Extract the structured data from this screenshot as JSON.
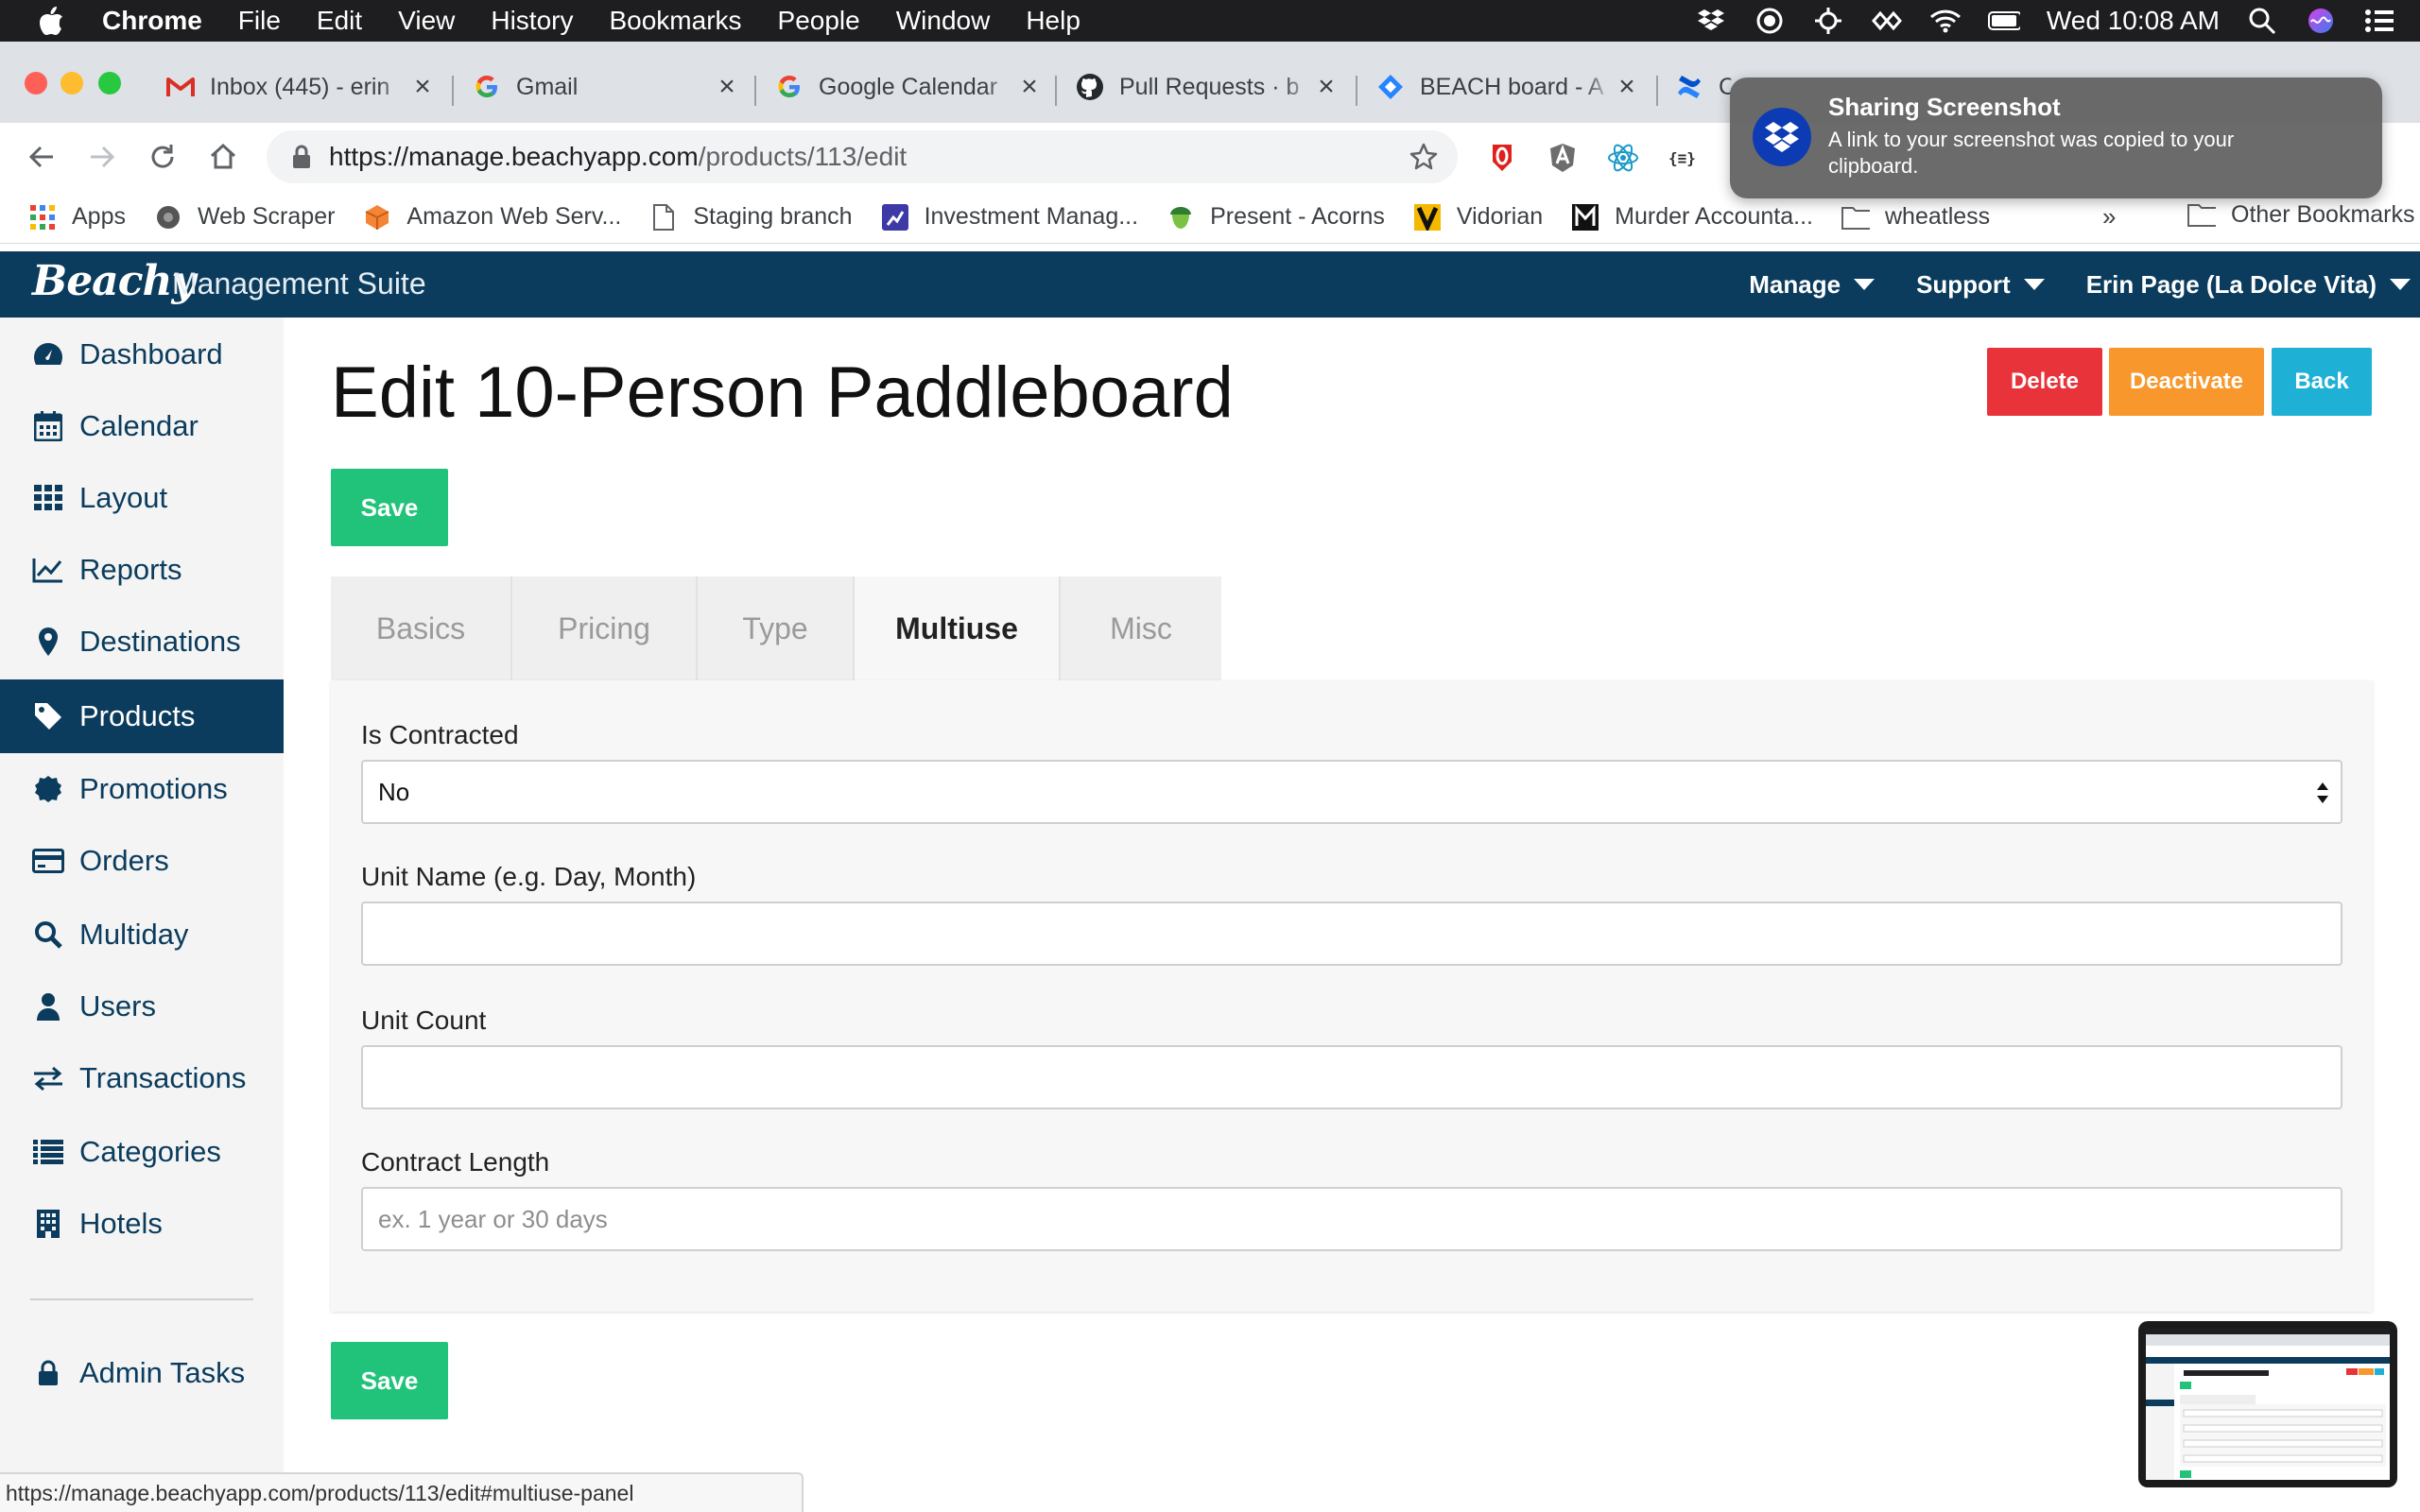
{
  "menubar": {
    "app_name": "Chrome",
    "items": [
      "File",
      "Edit",
      "View",
      "History",
      "Bookmarks",
      "People",
      "Window",
      "Help"
    ],
    "clock": "Wed 10:08 AM"
  },
  "tabs": [
    {
      "title": "Inbox (445) - erin",
      "icon": "gmail-icon"
    },
    {
      "title": "Gmail",
      "icon": "google-icon"
    },
    {
      "title": "Google Calendar",
      "icon": "google-icon"
    },
    {
      "title": "Pull Requests · b",
      "icon": "github-icon"
    },
    {
      "title": "BEACH board - A",
      "icon": "jira-icon"
    },
    {
      "title": "C",
      "icon": "confluence-icon"
    }
  ],
  "omnibox": {
    "host": "https://manage.beachyapp.com",
    "path": "/products/113/edit"
  },
  "bookmarks": {
    "items": [
      "Apps",
      "Web Scraper",
      "Amazon Web Serv...",
      "Staging branch",
      "Investment Manag...",
      "Present - Acorns",
      "Vidorian",
      "Murder Accounta...",
      "wheatless"
    ],
    "more": "»",
    "other": "Other Bookmarks"
  },
  "app": {
    "brand": "Beachy",
    "subtitle": "Management Suite",
    "nav": [
      "Manage",
      "Support",
      "Erin Page (La Dolce Vita)"
    ]
  },
  "sidebar": {
    "items": [
      {
        "label": "Dashboard",
        "icon": "dashboard-icon"
      },
      {
        "label": "Calendar",
        "icon": "calendar-icon"
      },
      {
        "label": "Layout",
        "icon": "grid-icon"
      },
      {
        "label": "Reports",
        "icon": "line-chart-icon"
      },
      {
        "label": "Destinations",
        "icon": "map-pin-icon"
      },
      {
        "label": "Products",
        "icon": "tag-icon"
      },
      {
        "label": "Promotions",
        "icon": "certificate-icon"
      },
      {
        "label": "Orders",
        "icon": "credit-card-icon"
      },
      {
        "label": "Multiday",
        "icon": "search-icon"
      },
      {
        "label": "Users",
        "icon": "user-icon"
      },
      {
        "label": "Transactions",
        "icon": "exchange-icon"
      },
      {
        "label": "Categories",
        "icon": "list-icon"
      },
      {
        "label": "Hotels",
        "icon": "building-icon"
      }
    ],
    "admin": {
      "label": "Admin Tasks",
      "icon": "lock-icon"
    },
    "active_item": "Products"
  },
  "main": {
    "title": "Edit 10-Person Paddleboard",
    "actions": {
      "delete": "Delete",
      "deactivate": "Deactivate",
      "back": "Back"
    },
    "save_label": "Save",
    "tabs": [
      "Basics",
      "Pricing",
      "Type",
      "Multiuse",
      "Misc"
    ],
    "active_tab": "Multiuse",
    "form": {
      "is_contracted": {
        "label": "Is Contracted",
        "value": "No"
      },
      "unit_name": {
        "label": "Unit Name (e.g. Day, Month)",
        "value": ""
      },
      "unit_count": {
        "label": "Unit Count",
        "value": ""
      },
      "contract_length": {
        "label": "Contract Length",
        "value": "",
        "placeholder": "ex. 1 year or 30 days"
      }
    }
  },
  "notification": {
    "title": "Sharing Screenshot",
    "body": "A link to your screenshot was copied to your clipboard."
  },
  "status_url": "https://manage.beachyapp.com/products/113/edit#multiuse-panel",
  "colors": {
    "navbar": "#0b3c5d",
    "save": "#21c37a",
    "delete": "#e8333a",
    "deactivate": "#f7972c",
    "back": "#1fb0d6"
  }
}
